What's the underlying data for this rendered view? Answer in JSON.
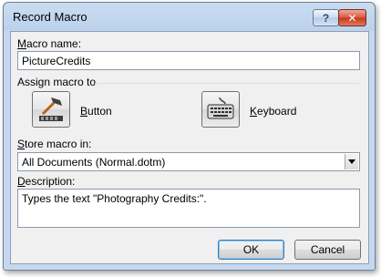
{
  "window": {
    "title": "Record Macro",
    "help_label": "?",
    "close_label": "✕"
  },
  "form": {
    "macro_name": {
      "label_first": "M",
      "label_rest": "acro name:",
      "value": "PictureCredits"
    },
    "assign_macro_to": {
      "label": "Assign macro to"
    },
    "button_option": {
      "label_first": "B",
      "label_rest": "utton",
      "icon": "hammer-icon"
    },
    "keyboard_option": {
      "label_first": "K",
      "label_rest": "eyboard",
      "icon": "keyboard-icon"
    },
    "store_macro_in": {
      "label_first": "S",
      "label_rest": "tore macro in:",
      "selected": "All Documents (Normal.dotm)"
    },
    "description": {
      "label_first": "D",
      "label_rest": "escription:",
      "value": "Types the text \"Photography Credits:\"."
    }
  },
  "buttons": {
    "ok": "OK",
    "cancel": "Cancel"
  }
}
